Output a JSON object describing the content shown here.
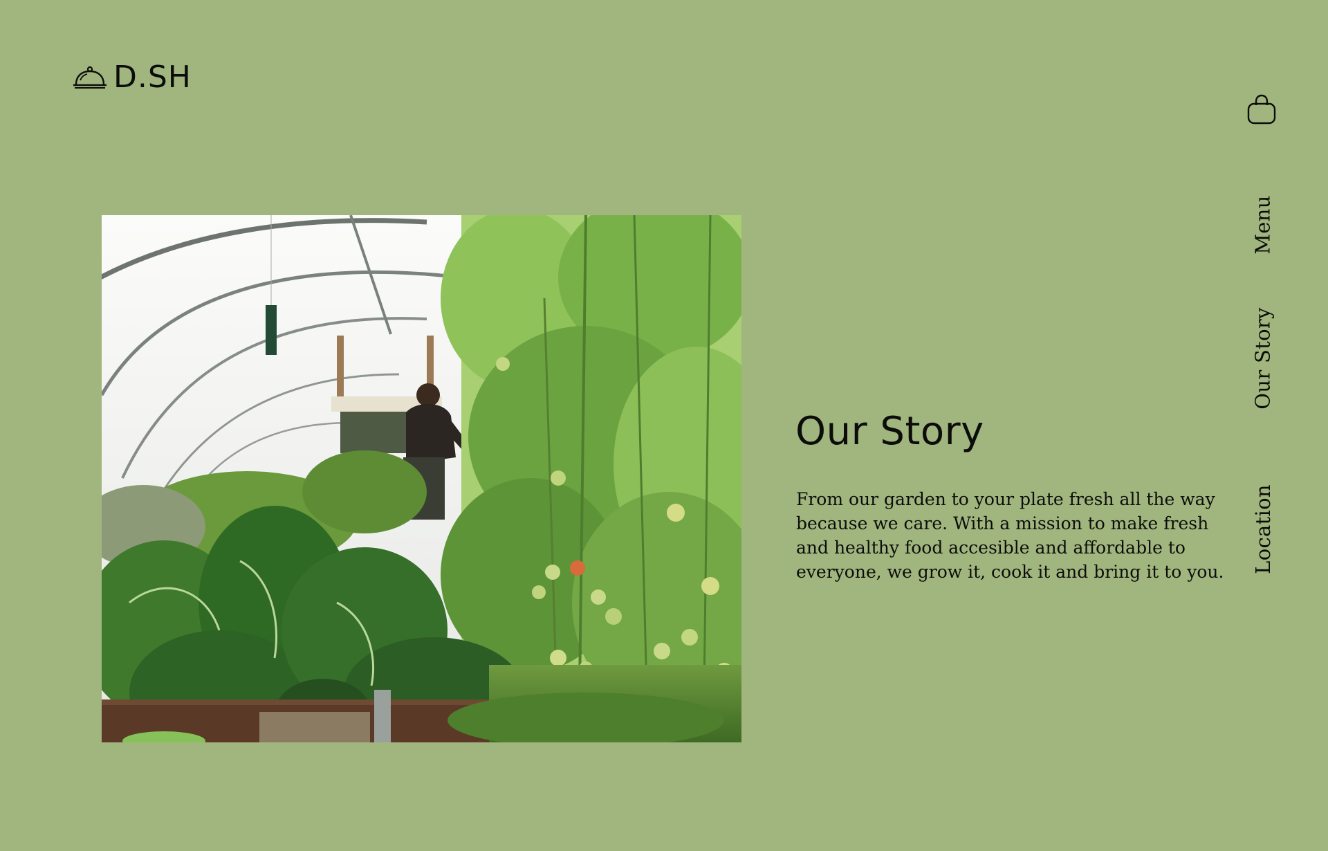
{
  "brand": {
    "logo_text": "D.SH",
    "logo_icon": "cloche-icon"
  },
  "header": {
    "cart_icon": "shopping-bag-icon"
  },
  "nav": {
    "items": [
      {
        "label": "Menu"
      },
      {
        "label": "Our Story"
      },
      {
        "label": "Location"
      }
    ]
  },
  "hero": {
    "image_subject": "greenhouse-photo"
  },
  "story": {
    "title": "Our Story",
    "body": "From our garden to your plate fresh all the way because we care. With a mission to make fresh and healthy food accesible and affordable to everyone, we  grow it, cook it and bring it to you."
  },
  "colors": {
    "background": "#a1b67e",
    "text": "#0c0d0a",
    "leaf_dark": "#2f5a22",
    "leaf_light": "#8fc35a",
    "tomato": "#c9d98a"
  }
}
